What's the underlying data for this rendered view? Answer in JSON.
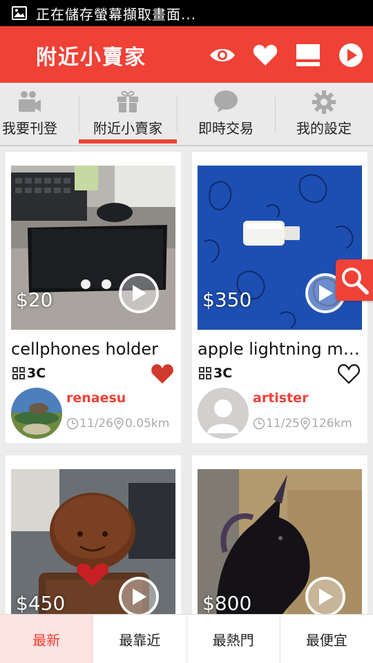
{
  "status_bar": {
    "text": "正在儲存螢幕擷取畫面..."
  },
  "app_bar": {
    "title": "附近小賣家",
    "actions": [
      "eye-icon",
      "heart-icon",
      "list-icon",
      "play-icon"
    ]
  },
  "tabs": [
    {
      "label": "我要刊登",
      "icon": "camera-icon"
    },
    {
      "label": "附近小賣家",
      "icon": "gift-icon",
      "selected": true
    },
    {
      "label": "即時交易",
      "icon": "chat-bubble-icon"
    },
    {
      "label": "我的設定",
      "icon": "gear-icon"
    }
  ],
  "listings": [
    {
      "price": "$20",
      "title": "cellphones holder",
      "category": "3C",
      "seller": "renaesu",
      "date": "11/26",
      "distance": "0.05km",
      "favorited": true
    },
    {
      "price": "$350",
      "title": "apple lightning mi...",
      "category": "3C",
      "seller": "artister",
      "date": "11/25",
      "distance": "126km",
      "favorited": false
    },
    {
      "price": "$450",
      "title": "",
      "category": "",
      "seller": "",
      "date": "",
      "distance": ""
    },
    {
      "price": "$800",
      "title": "",
      "category": "",
      "seller": "",
      "date": "",
      "distance": ""
    }
  ],
  "bottom_bar": {
    "items": [
      {
        "label": "最新",
        "active": true
      },
      {
        "label": "最靠近",
        "active": false
      },
      {
        "label": "最熱門",
        "active": false
      },
      {
        "label": "最便宜",
        "active": false
      }
    ]
  },
  "colors": {
    "accent": "#ef4136",
    "favorite": "#d0392e"
  }
}
